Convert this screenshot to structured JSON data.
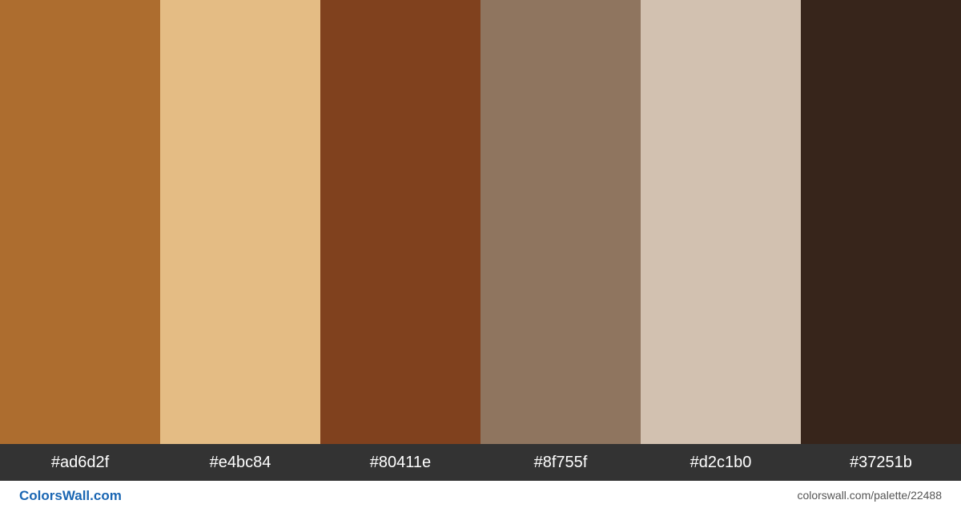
{
  "palette": {
    "swatches": [
      {
        "hex": "#ad6d2f",
        "label": "#ad6d2f"
      },
      {
        "hex": "#e4bc84",
        "label": "#e4bc84"
      },
      {
        "hex": "#80411e",
        "label": "#80411e"
      },
      {
        "hex": "#8f755f",
        "label": "#8f755f"
      },
      {
        "hex": "#d2c1b0",
        "label": "#d2c1b0"
      },
      {
        "hex": "#37251b",
        "label": "#37251b"
      }
    ]
  },
  "footer": {
    "brand": "ColorsWall.com",
    "url": "colorswall.com/palette/22488"
  },
  "colors": {
    "label_bar": "#333333",
    "brand_link": "#1a66b3"
  }
}
